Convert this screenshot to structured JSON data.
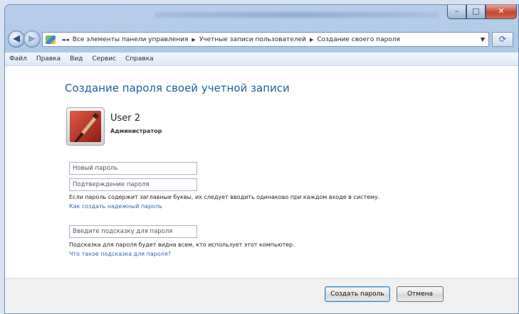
{
  "address": {
    "crumbs": [
      "Все элементы панели управления",
      "Учетные записи пользователей",
      "Создание своего пароля"
    ],
    "refresh_icon": "refresh-icon"
  },
  "menu": {
    "items": [
      "Файл",
      "Правка",
      "Вид",
      "Сервис",
      "Справка"
    ]
  },
  "page": {
    "title": "Создание пароля своей учетной записи"
  },
  "user": {
    "name": "User 2",
    "role": "Администратор"
  },
  "fields": {
    "new_password_placeholder": "Новый пароль",
    "confirm_password_placeholder": "Подтверждение пароля",
    "hint_placeholder": "Введите подсказку для пароля"
  },
  "notes": {
    "case_sensitive": "Если пароль содержит заглавные буквы, их следует вводить одинаково при каждом входе в систему.",
    "strong_password_link": "Как создать надежный пароль",
    "hint_visible": "Подсказка для пароля будет видна всем, кто использует этот компьютер.",
    "hint_link": "Что такое подсказка для пароля?"
  },
  "buttons": {
    "create": "Создать пароль",
    "cancel": "Отмена"
  },
  "colors": {
    "title": "#1e5fa8",
    "link": "#2e64b8",
    "close_button": "#c6442f"
  }
}
